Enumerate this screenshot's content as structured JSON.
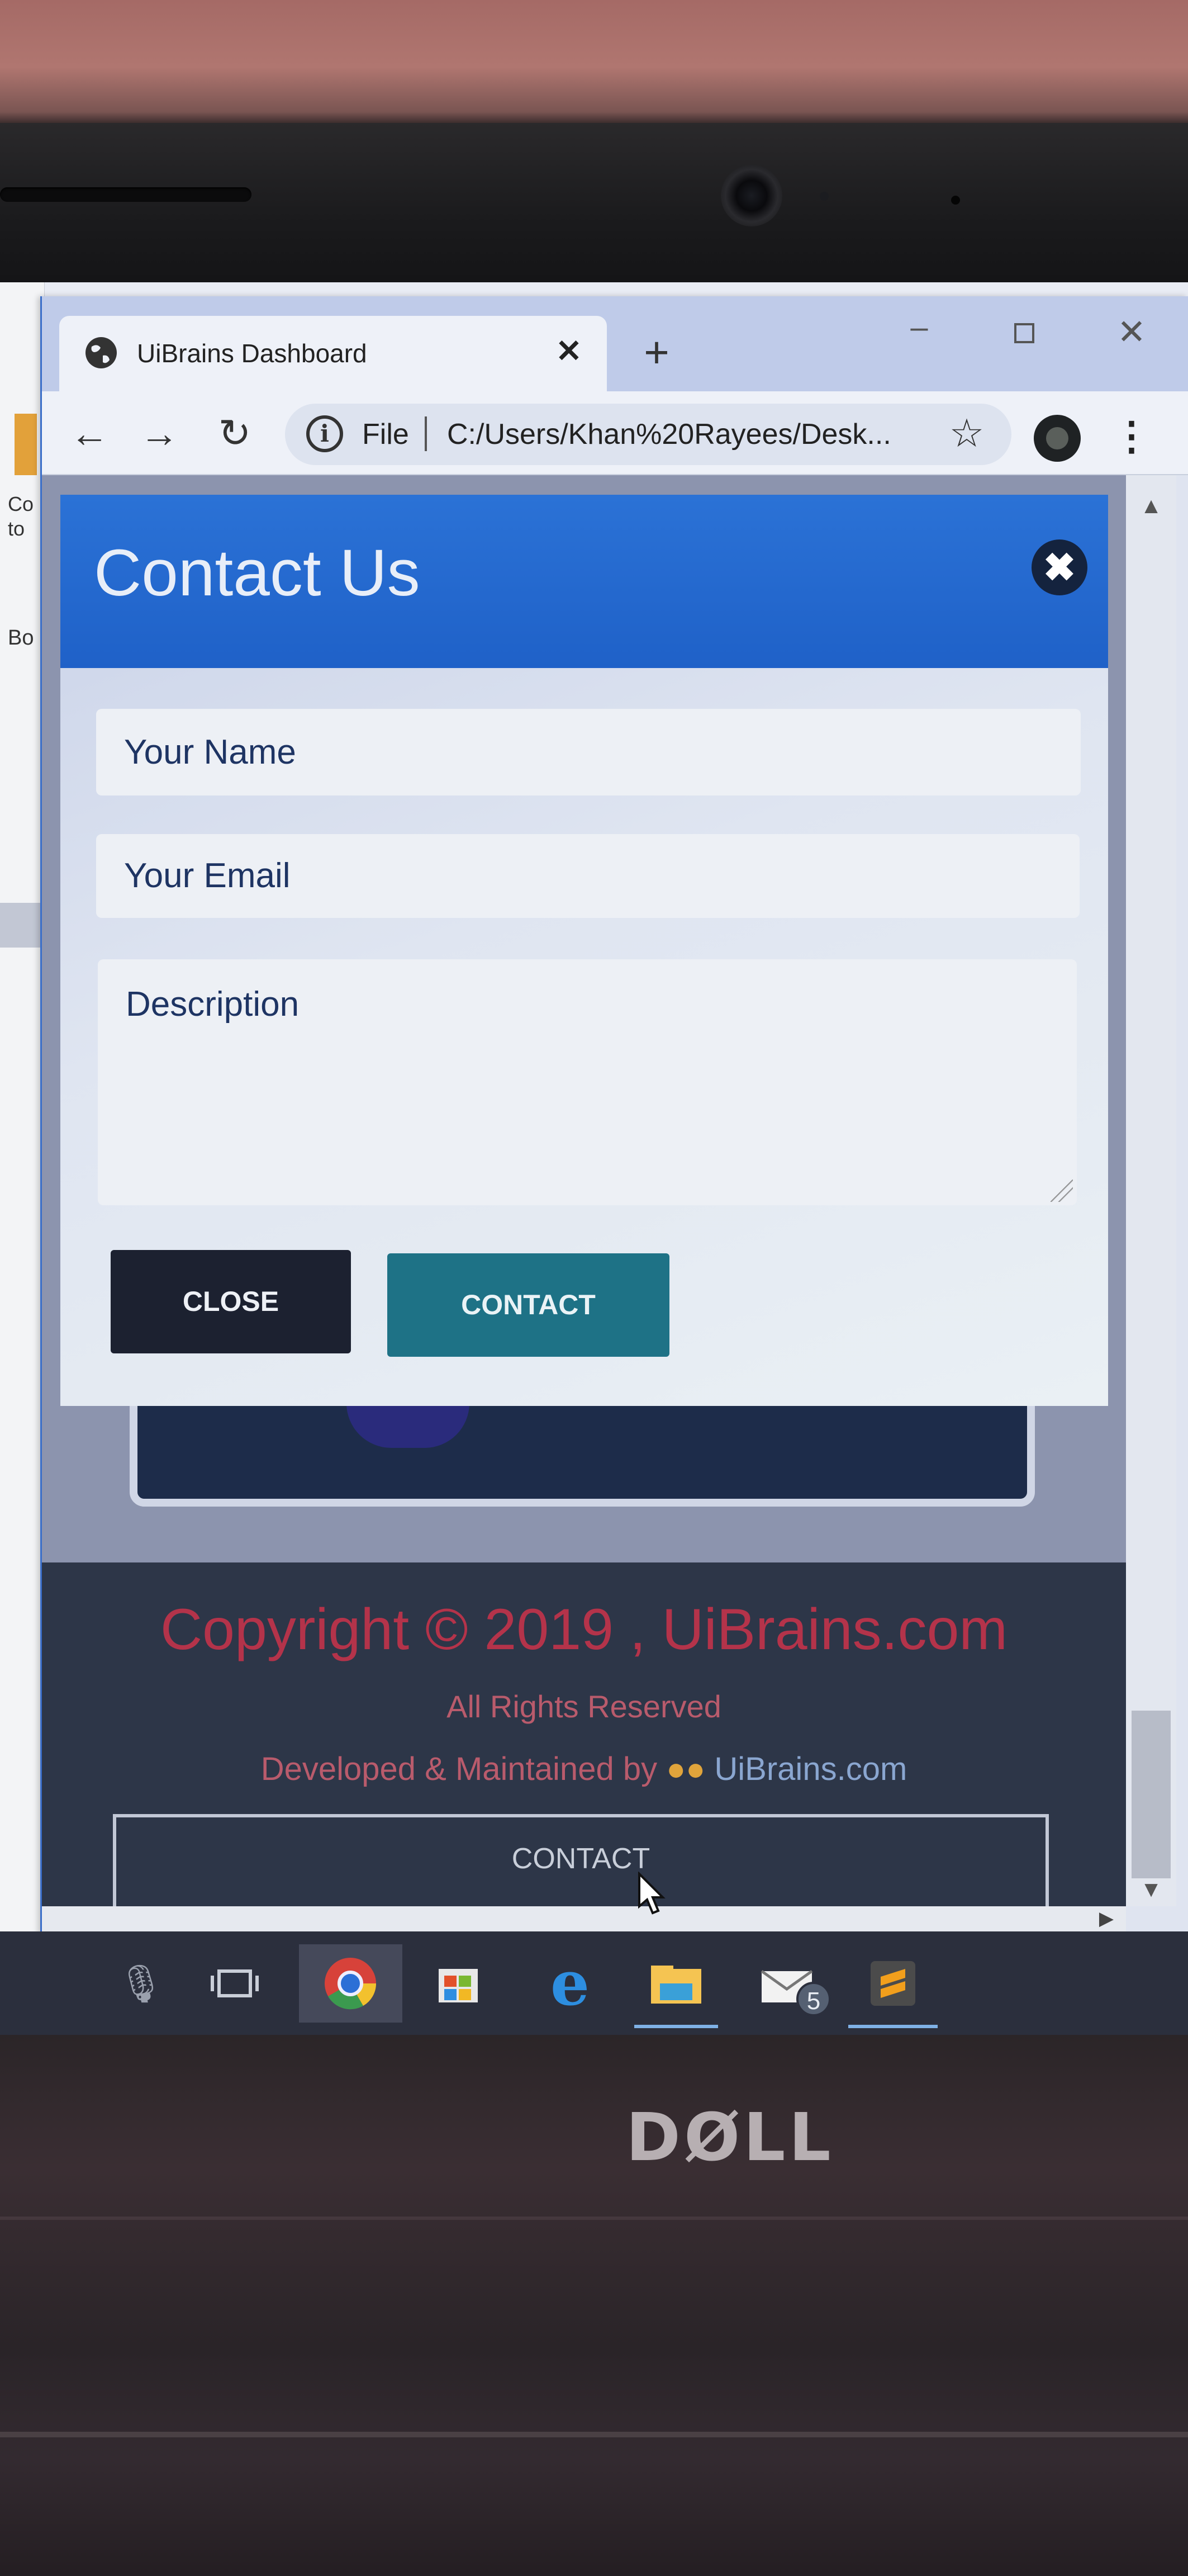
{
  "browser": {
    "tab_title": "UiBrains Dashboard",
    "tab_close": "✕",
    "new_tab": "+",
    "url_scheme_label": "File",
    "url": "C:/Users/Khan%20Rayees/Desk...",
    "icons": [
      "globe-icon",
      "back-arrow-icon",
      "forward-arrow-icon",
      "reload-icon",
      "info-icon",
      "star-icon",
      "extension-icon",
      "menu-dots-icon"
    ]
  },
  "modal": {
    "title": "Contact Us",
    "close_icon": "✖",
    "name_placeholder": "Your Name",
    "email_placeholder": "Your Email",
    "description_placeholder": "Description",
    "close_button": "CLOSE",
    "contact_button": "CONTACT",
    "colors": {
      "header": "#2168d0",
      "close_button": "#1c2130",
      "contact_button": "#1e7286"
    }
  },
  "footer": {
    "copyright": "Copyright © 2019 , UiBrains.com",
    "rights": "All Rights Reserved",
    "developed_by_label": "Developed & Maintained by",
    "developer_site": "UiBrains.com",
    "users_icon": "users-icon",
    "contact_button": "CONTACT",
    "colors": {
      "background": "#2d3648",
      "copyright_text": "#b4334a"
    }
  },
  "desktop_edge": {
    "text_top": "Co\nto",
    "text_mid": "Bo"
  },
  "taskbar": {
    "mail_badge": "5",
    "icons": [
      "microphone-icon",
      "task-view-icon",
      "chrome-icon",
      "store-icon",
      "edge-icon",
      "file-explorer-icon",
      "mail-icon",
      "sublime-text-icon"
    ]
  },
  "hardware": {
    "brand": "DØLL"
  }
}
